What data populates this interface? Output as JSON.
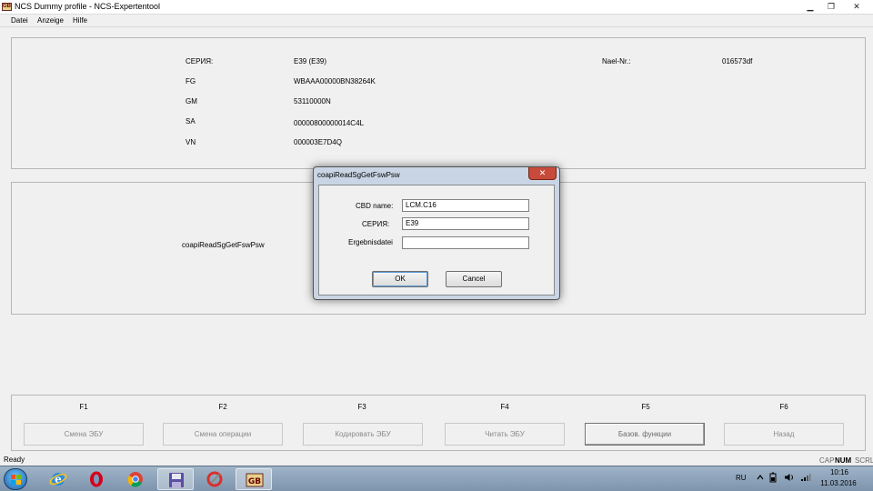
{
  "window": {
    "title": "NCS Dummy profile - NCS-Expertentool",
    "icon_text": "GB",
    "controls": {
      "minimize": "▁",
      "maximize": "❐",
      "close": "✕"
    }
  },
  "menu": [
    "Datei",
    "Anzeige",
    "Hilfe"
  ],
  "info": {
    "serie_label": "СЕРИЯ:",
    "serie_value": "E39 (E39)",
    "fg_label": "FG",
    "fg_value": "WBAAA00000BN38264K",
    "gm_label": "GM",
    "gm_value": "53110000N",
    "sa_label": "SA",
    "sa_value": "00000800000014C4L",
    "vn_label": "VN",
    "vn_value": "000003E7D4Q",
    "nael_label": "Nael-Nr.:",
    "nael_value": "016573df"
  },
  "mid_panel": {
    "job_text": "coapiReadSgGetFswPsw"
  },
  "function_keys": [
    {
      "key": "F1",
      "label": "Смена ЭБУ",
      "active": false
    },
    {
      "key": "F2",
      "label": "Смена операции",
      "active": false
    },
    {
      "key": "F3",
      "label": "Кодировать ЭБУ",
      "active": false
    },
    {
      "key": "F4",
      "label": "Читать ЭБУ",
      "active": false
    },
    {
      "key": "F5",
      "label": "Базов. функции",
      "active": true
    },
    {
      "key": "F6",
      "label": "Назад",
      "active": false
    }
  ],
  "statusbar": {
    "text": "Ready",
    "cap": "CAP",
    "num": "NUM",
    "scrl": "SCRL"
  },
  "dialog": {
    "title": "coapiReadSgGetFswPsw",
    "close": "✕",
    "cbd_label": "CBD name:",
    "cbd_value": "LCM.C16",
    "serie_label": "СЕРИЯ:",
    "serie_value": "E39",
    "ergebnis_label": "Ergebnisdatei",
    "ergebnis_value": "",
    "ok_label": "OK",
    "cancel_label": "Cancel"
  },
  "taskbar": {
    "apps": [
      "internet-explorer",
      "opera",
      "chrome",
      "save-floppy",
      "ccleaner",
      "ncs-expert"
    ],
    "lang": "RU",
    "time": "10:16",
    "date": "11.03.2016"
  }
}
